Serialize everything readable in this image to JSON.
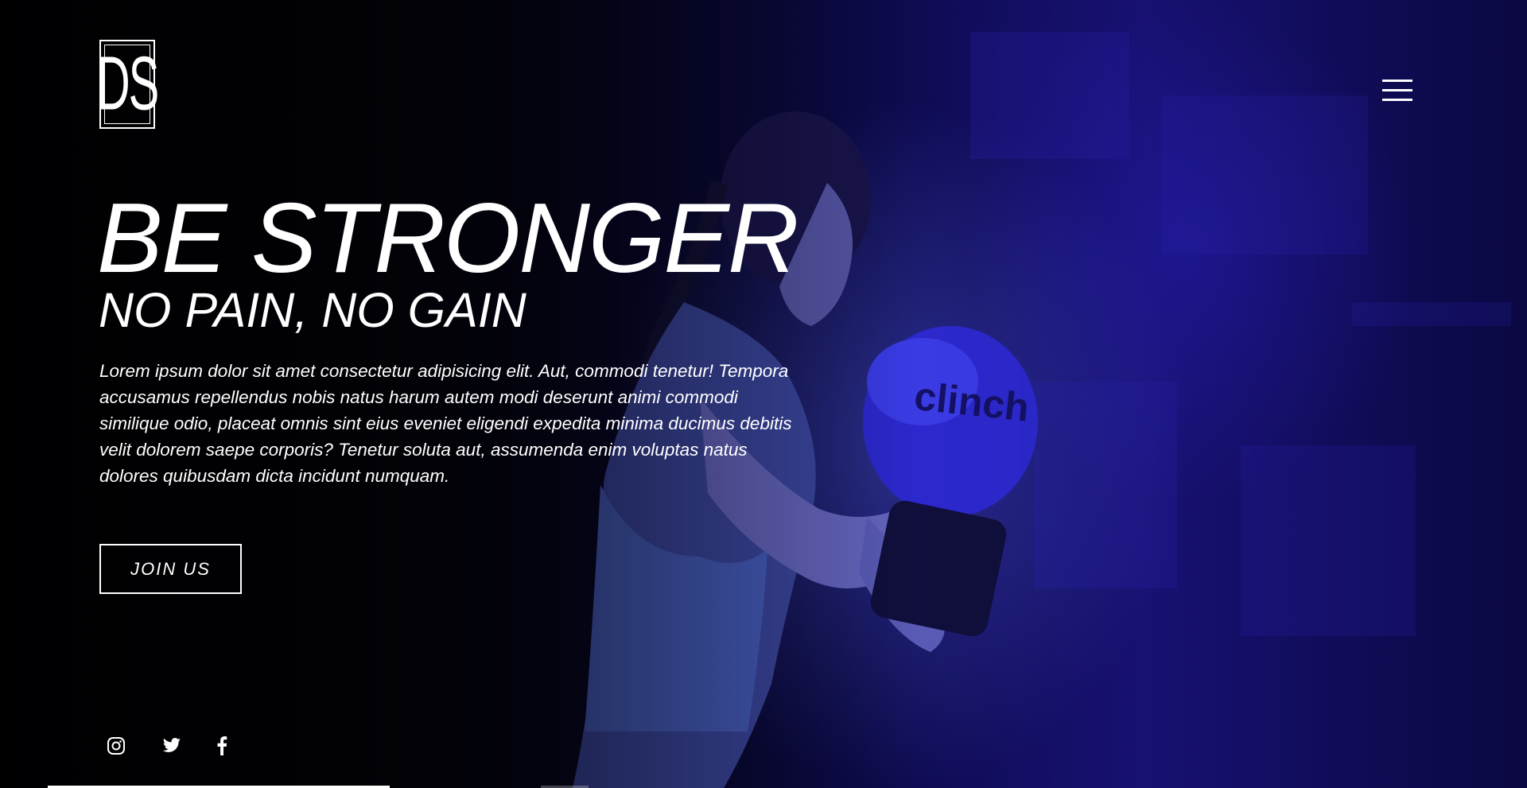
{
  "brand": {
    "logo_text": "DS"
  },
  "header": {
    "menu_icon": "hamburger-menu-icon"
  },
  "hero": {
    "headline": "BE STRONGER",
    "subheadline": "NO PAIN, NO GAIN",
    "body": "Lorem ipsum dolor sit amet consectetur adipisicing elit. Aut, commodi tenetur! Tempora accusamus repellendus nobis natus harum autem modi deserunt animi commodi similique odio, placeat omnis sint eius eveniet eligendi expedita minima ducimus debitis velit dolorem saepe corporis? Tenetur soluta aut, assumenda enim voluptas natus dolores quibusdam dicta incidunt numquam.",
    "cta_label": "JOIN US"
  },
  "social": [
    {
      "name": "instagram",
      "icon": "instagram-icon"
    },
    {
      "name": "twitter",
      "icon": "twitter-icon"
    },
    {
      "name": "facebook",
      "icon": "facebook-icon"
    }
  ],
  "colors": {
    "accent": "#1a1380",
    "text": "#ffffff",
    "background": "#000000"
  }
}
